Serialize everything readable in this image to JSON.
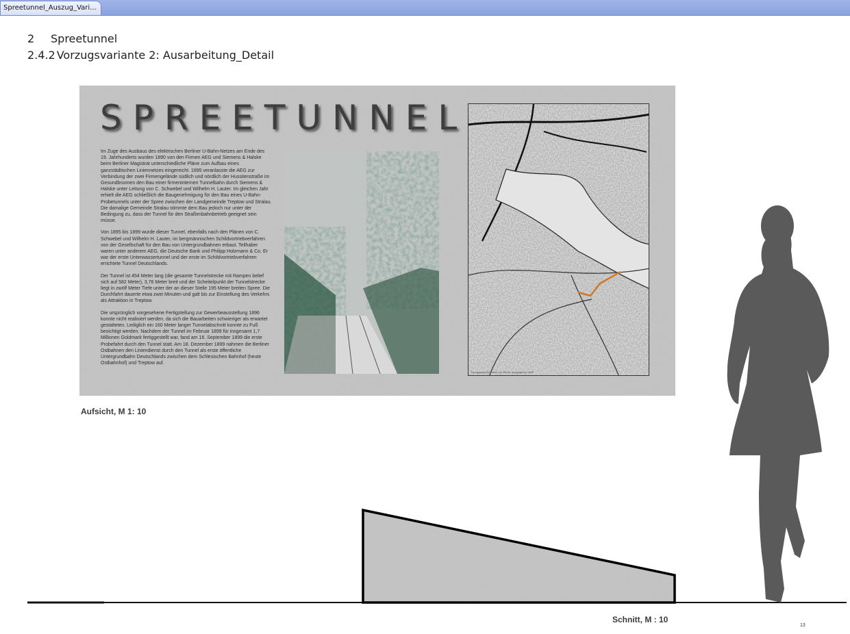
{
  "tab": {
    "label": "Spreetunnel_Auszug_Vari..."
  },
  "heading": {
    "chapter_number": "2",
    "chapter_title": "Spreetunnel",
    "section_number": "2.4.2",
    "section_title": "Vorzugsvariante 2:  Ausarbeitung_Detail"
  },
  "poster": {
    "title": "SPREETUNNEL",
    "paragraphs": [
      "Im Zuge des Ausbaus des elektrischen Berliner U-Bahn-Netzes am Ende des 19. Jahrhunderts wurden 1890 von den Firmen AEG und Siemens & Halske beim Berliner Magistrat unterschiedliche Pläne zum Aufbau eines ganzstädtischen Liniennetzes eingereicht. 1895 veranlasste die AEG zur Verbindung der zwei Firmengelände südlich und nördlich der Hussitenstraße im Gesundbrunnen den Bau einer firmeninternen Tunnelbahn durch Siemens & Halske unter Leitung von C. Schwebel und Wilhelm H. Lauter. Im gleichen Jahr erhielt die AEG schließlich die Baugenehmigung für den Bau eines U-Bahn-Probetunnels unter der Spree zwischen der Landgemeinde Treptow und Stralau. Die damalige Gemeinde Stralau stimmte dem Bau jedoch nur unter der Bedingung zu, dass der Tunnel für den Straßenbahnbetrieb geeignet sein müsse.",
      "Von 1895 bis 1899 wurde dieser Tunnel, ebenfalls nach den Plänen von C. Schwebel und Wilhelm H. Lauter, im bergmännischen Schildvortriebverfahren von der Gesellschaft für den Bau von Untergrundbahnen erbaut. Teilhaber waren unter anderem AEG, die Deutsche Bank und Philipp Holzmann & Co. Er war der erste Unterwassertunnel und der erste im Schildvortriebverfahren errichtete Tunnel Deutschlands.",
      "Der Tunnel ist 454 Meter lang (die gesamte Tunnelstrecke mit Rampen belief sich auf 582 Meter), 3,76 Meter breit und der Scheitelpunkt der Tunnelstrecke liegt in zwölf Meter Tiefe unter der an dieser Stelle 195 Meter breiten Spree. Die Durchfahrt dauerte etwa zwei Minuten und galt bis zur Einstellung des Verkehrs als Attraktion in Treptow.",
      "Die ursprünglich vorgesehene Fertigstellung zur Gewerbeausstellung 1896 konnte nicht realisiert werden, da sich die Bauarbeiten schwieriger als erwartet gestalteten. Lediglich ein 160 Meter langer Tunnelabschnitt konnte zu Fuß besichtigt werden. Nachdem der Tunnel im Februar 1899 für insgesamt 1,7 Millionen Goldmark fertiggestellt war, fand am 16. September 1899 die erste Probefahrt durch den Tunnel statt. Am 18. Dezember 1899 nahmen die Berliner Ostbahnen den Liniendienst durch den Tunnel als erste öffentliche Untergrundbahn Deutschlands zwischen dem Schlesischen Bahnhof (heute Ostbahnhof) und Treptow auf."
    ],
    "map_caption": "Topographische Karte von Berlin, ausgegeben 1899",
    "colors": {
      "photo_green": "#2f5a45",
      "route_orange": "#d07820",
      "poster_grey": "#c2c2c2"
    }
  },
  "labels": {
    "aufsicht": "Aufsicht, M 1: 10",
    "schnitt": "Schnitt, M : 10",
    "page_number": "13"
  }
}
